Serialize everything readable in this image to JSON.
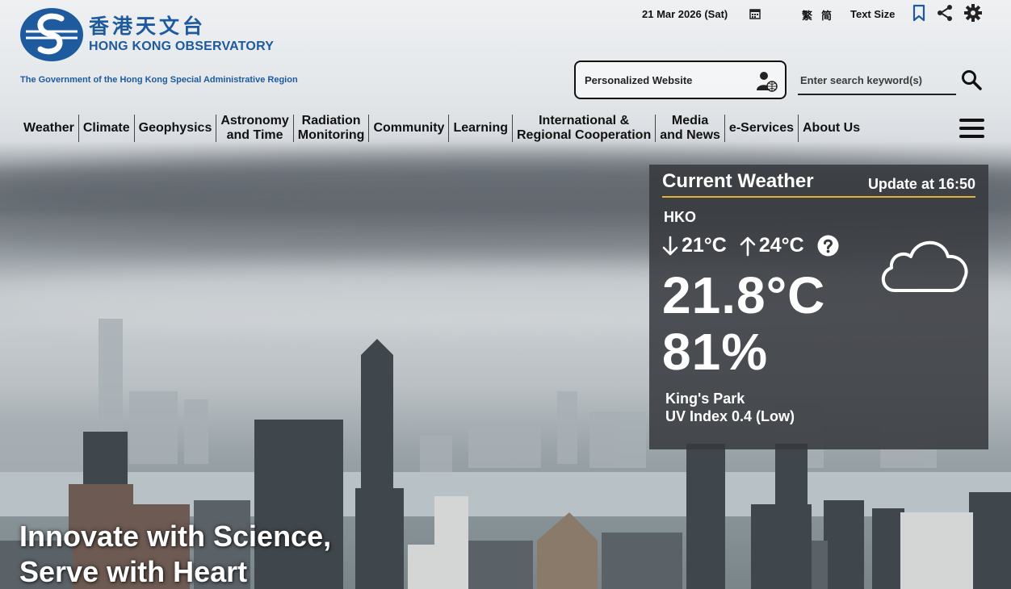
{
  "header": {
    "logo_cn": "香港天文台",
    "logo_en": "HONG KONG OBSERVATORY",
    "gov_line": "The Government of the Hong Kong Special Administrative Region"
  },
  "topbar": {
    "date": "21 Mar 2026 (Sat)",
    "lang_trad": "繁",
    "lang_simp": "简",
    "text_size": "Text Size"
  },
  "personalized": {
    "label": "Personalized Website"
  },
  "search": {
    "placeholder": "Enter search keyword(s)"
  },
  "nav": {
    "items": [
      {
        "label": "Weather"
      },
      {
        "label": "Climate"
      },
      {
        "label": "Geophysics"
      },
      {
        "label": "Astronomy\nand Time"
      },
      {
        "label": "Radiation\nMonitoring"
      },
      {
        "label": "Community"
      },
      {
        "label": "Learning"
      },
      {
        "label": "International &\nRegional Cooperation"
      },
      {
        "label": "Media\nand News"
      },
      {
        "label": "e-Services"
      },
      {
        "label": "About Us"
      }
    ]
  },
  "weather": {
    "title": "Current Weather",
    "update": "Update at 16:50",
    "station": "HKO",
    "min_temp": "21°C",
    "max_temp": "24°C",
    "temperature": "21.8°C",
    "humidity": "81%",
    "uv_station": "King's Park",
    "uv_index": "UV Index 0.4 (Low)",
    "icon": "cloudy-icon"
  },
  "hero": {
    "line1": "Innovate with Science,",
    "line2": "Serve with Heart"
  },
  "colors": {
    "brand_blue": "#1d5a9e",
    "panel_accent": "#e2b23a",
    "panel_bg": "#36383c"
  }
}
